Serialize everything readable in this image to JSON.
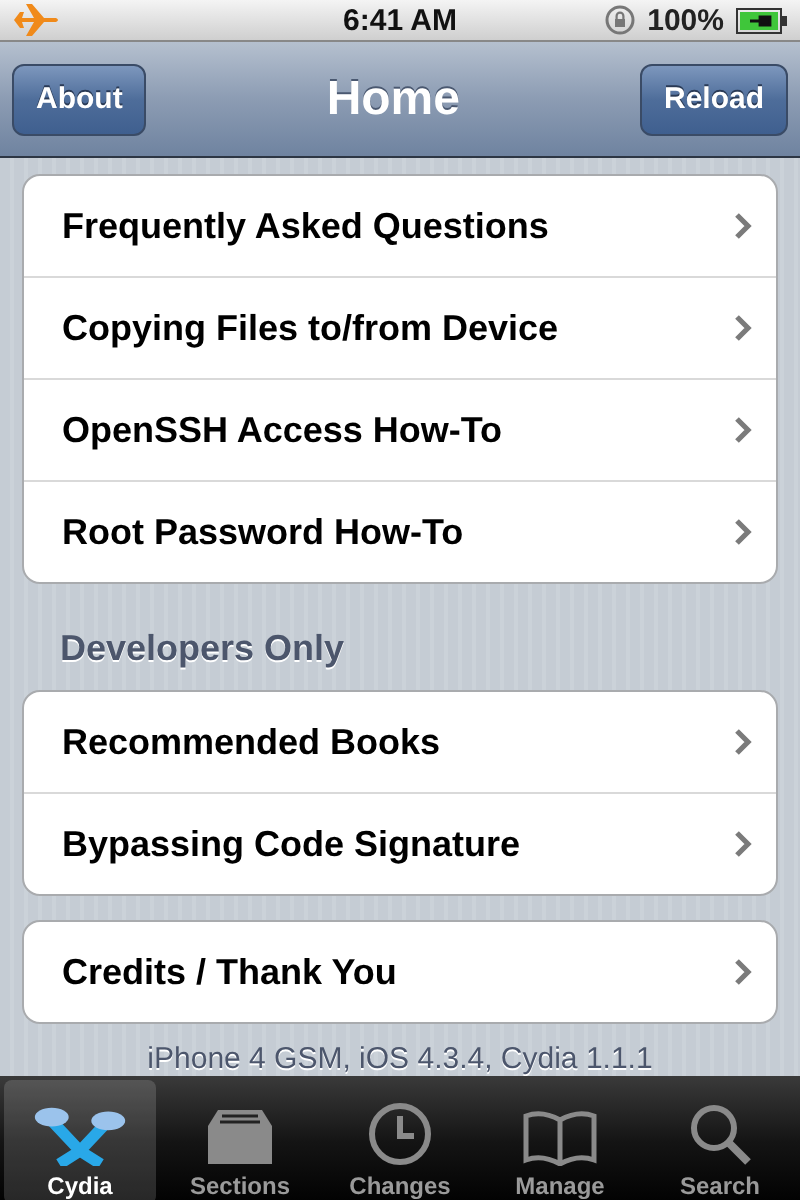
{
  "status_bar": {
    "time": "6:41 AM",
    "battery": "100%"
  },
  "nav_bar": {
    "title": "Home",
    "left_button": "About",
    "right_button": "Reload"
  },
  "sections": [
    {
      "rows": [
        "Frequently Asked Questions",
        "Copying Files to/from Device",
        "OpenSSH Access How-To",
        "Root Password How-To"
      ]
    },
    {
      "header": "Developers Only",
      "rows": [
        "Recommended Books",
        "Bypassing Code Signature"
      ]
    },
    {
      "rows": [
        "Credits / Thank You"
      ]
    }
  ],
  "footer": "iPhone 4 GSM, iOS 4.3.4, Cydia 1.1.1",
  "tabs": [
    {
      "kind": "cydia",
      "label": "Cydia",
      "selected": true
    },
    {
      "kind": "sections",
      "label": "Sections",
      "selected": false
    },
    {
      "kind": "changes",
      "label": "Changes",
      "selected": false
    },
    {
      "kind": "manage",
      "label": "Manage",
      "selected": false
    },
    {
      "kind": "search",
      "label": "Search",
      "selected": false
    }
  ]
}
